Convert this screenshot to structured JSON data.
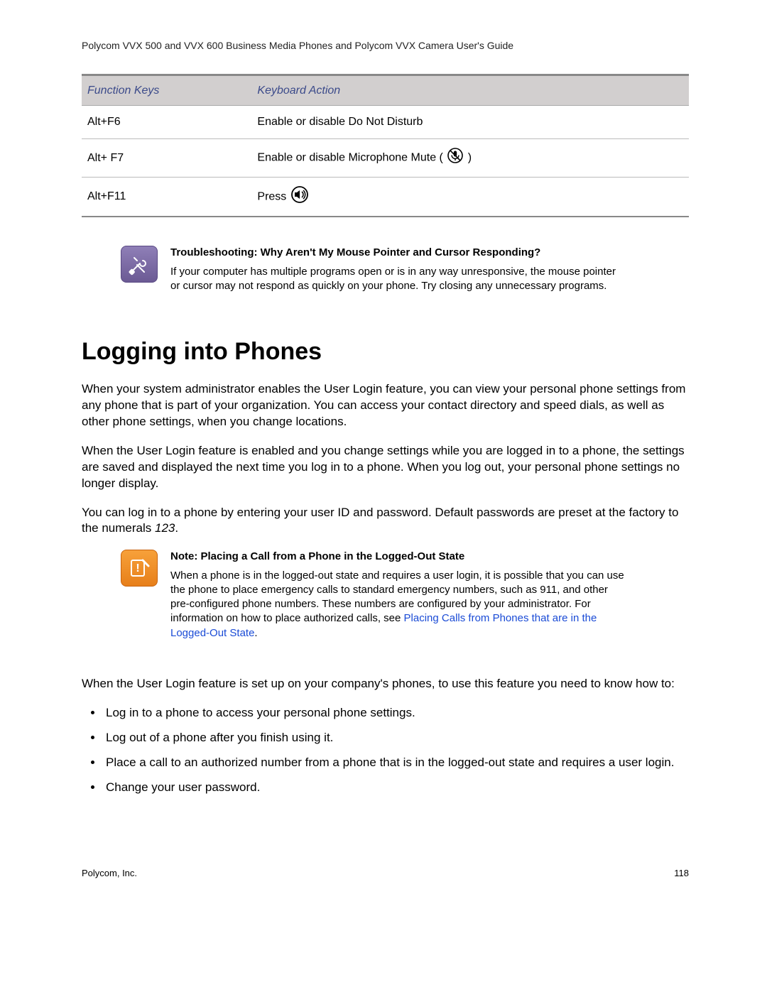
{
  "header": "Polycom VVX 500 and VVX 600 Business Media Phones and Polycom VVX Camera User's Guide",
  "table": {
    "col1": "Function Keys",
    "col2": "Keyboard Action",
    "rows": [
      {
        "key": "Alt+F6",
        "action": "Enable or disable Do Not Disturb",
        "icon": "none"
      },
      {
        "key": "Alt+ F7",
        "action": "Enable or disable Microphone Mute (",
        "icon": "mic",
        "action_suffix": ")"
      },
      {
        "key": "Alt+F11",
        "action": "Press ",
        "icon": "speaker",
        "action_suffix": ""
      }
    ]
  },
  "troubleshoot": {
    "title": "Troubleshooting: Why Aren't My Mouse Pointer and Cursor Responding?",
    "body": "If your computer has multiple programs open or is in any way unresponsive, the mouse pointer or cursor may not respond as quickly on your phone. Try closing any unnecessary programs."
  },
  "section_heading": "Logging into Phones",
  "para1": "When your system administrator enables the User Login feature, you can view your personal phone settings from any phone that is part of your organization. You can access your contact directory and speed dials, as well as other phone settings, when you change locations.",
  "para2": "When the User Login feature is enabled and you change settings while you are logged in to a phone, the settings are saved and displayed the next time you log in to a phone. When you log out, your personal phone settings no longer display.",
  "para3a": "You can log in to a phone by entering your user ID and password. Default passwords are preset at the factory to the numerals ",
  "para3b": "123",
  "para3c": ".",
  "note": {
    "title": "Note: Placing a Call from a Phone in the Logged-Out State",
    "body_a": "When a phone is in the logged-out state and requires a user login, it is possible that you can use the phone to place emergency calls to standard emergency numbers, such as 911, and other pre-configured phone numbers. These numbers are configured by your administrator. For information on how to place authorized calls, see ",
    "link": "Placing Calls from Phones that are in the Logged-Out State",
    "body_b": "."
  },
  "para4": "When the User Login feature is set up on your company's phones, to use this feature you need to know how to:",
  "bullets": [
    "Log in to a phone to access your personal phone settings.",
    "Log out of a phone after you finish using it.",
    "Place a call to an authorized number from a phone that is in the logged-out state and requires a user login.",
    "Change your user password."
  ],
  "footer": {
    "left": "Polycom, Inc.",
    "right": "118"
  }
}
